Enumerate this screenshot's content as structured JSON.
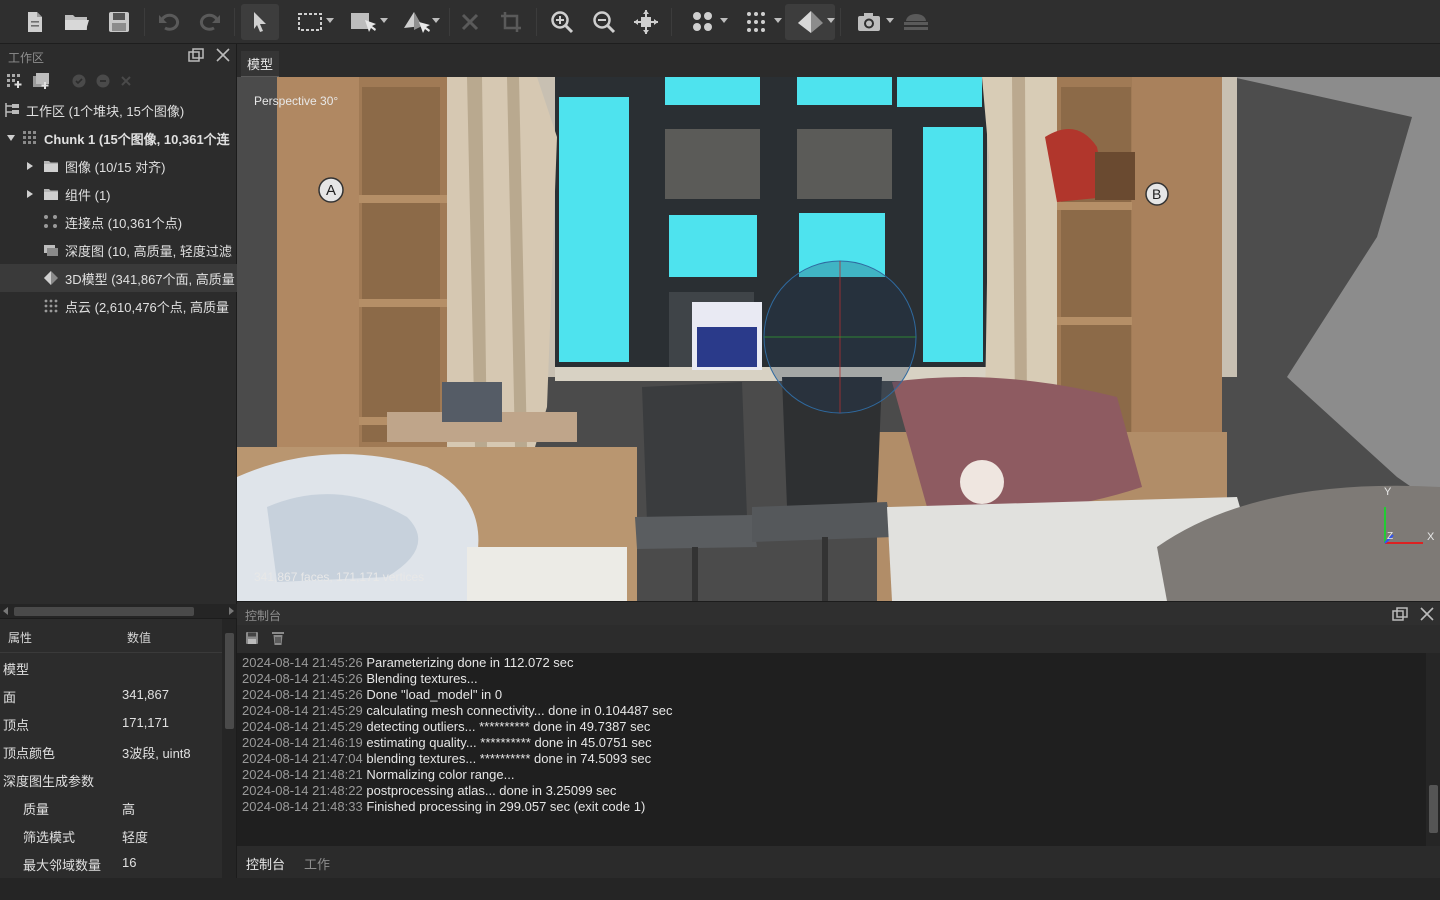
{
  "toolbar": {
    "buttons": [
      "new-document-icon",
      "open-folder-icon",
      "save-icon",
      "undo-icon",
      "redo-icon",
      "pointer-icon",
      "rect-select-icon",
      "region-select-icon",
      "rotate-object-icon",
      "delete-icon",
      "crop-icon",
      "zoom-in-icon",
      "zoom-out-icon",
      "move-icon",
      "points-icon",
      "dots-grid-icon",
      "model-icon",
      "camera-icon",
      "layers-icon"
    ]
  },
  "workspace": {
    "title": "工作区",
    "items": [
      {
        "label": "工作区 (1个堆块, 15个图像)",
        "icon": "workspace-icon"
      },
      {
        "label": "Chunk 1 (15个图像, 10,361个连",
        "icon": "chunk-icon"
      },
      {
        "label": "图像 (10/15 对齐)",
        "icon": "folder-icon"
      },
      {
        "label": "组件 (1)",
        "icon": "folder-icon"
      },
      {
        "label": "连接点 (10,361个点)",
        "icon": "tie-points-icon"
      },
      {
        "label": "深度图 (10, 高质量, 轻度过滤",
        "icon": "depth-map-icon"
      },
      {
        "label": "3D模型 (341,867个面, 高质量",
        "icon": "model-3d-icon"
      },
      {
        "label": "点云 (2,610,476个点, 高质量",
        "icon": "point-cloud-icon"
      }
    ]
  },
  "properties": {
    "col_property": "属性",
    "col_value": "数值",
    "rows": [
      {
        "k": "模型",
        "v": ""
      },
      {
        "k": "面",
        "v": "341,867"
      },
      {
        "k": "顶点",
        "v": "171,171"
      },
      {
        "k": "顶点颜色",
        "v": "3波段, uint8"
      },
      {
        "k": "深度图生成参数",
        "v": ""
      },
      {
        "k": "质量",
        "v": "高"
      },
      {
        "k": "筛选模式",
        "v": "轻度"
      },
      {
        "k": "最大邻域数量",
        "v": "16"
      }
    ]
  },
  "viewport": {
    "tab": "模型",
    "projection": "Perspective 30°",
    "stats": "341,867 faces, 171,171 vertices",
    "marker_a": "A",
    "marker_b": "B",
    "axis_y": "Y",
    "axis_z": "Z",
    "axis_x": "X"
  },
  "console": {
    "title": "控制台",
    "lines": [
      {
        "ts": "2024-08-14 21:45:26",
        "msg": "Parameterizing done in 112.072 sec"
      },
      {
        "ts": "2024-08-14 21:45:26",
        "msg": "Blending textures..."
      },
      {
        "ts": "2024-08-14 21:45:26",
        "msg": "Done \"load_model\" in 0"
      },
      {
        "ts": "2024-08-14 21:45:29",
        "msg": "calculating mesh connectivity... done in 0.104487 sec"
      },
      {
        "ts": "2024-08-14 21:45:29",
        "msg": "detecting outliers... ********** done in 49.7387 sec"
      },
      {
        "ts": "2024-08-14 21:46:19",
        "msg": "estimating quality... ********** done in 45.0751 sec"
      },
      {
        "ts": "2024-08-14 21:47:04",
        "msg": "blending textures...  ********** done in 74.5093 sec"
      },
      {
        "ts": "2024-08-14 21:48:21",
        "msg": "Normalizing color range..."
      },
      {
        "ts": "2024-08-14 21:48:22",
        "msg": "postprocessing atlas... done in 3.25099 sec"
      },
      {
        "ts": "2024-08-14 21:48:33",
        "msg": "Finished processing in 299.057 sec (exit code 1)"
      }
    ],
    "tab_console": "控制台",
    "tab_jobs": "工作"
  },
  "colors": {
    "accent_cyan": "#4ee3ee",
    "wood": "#a07a55",
    "window_frame": "#2a2f33"
  }
}
